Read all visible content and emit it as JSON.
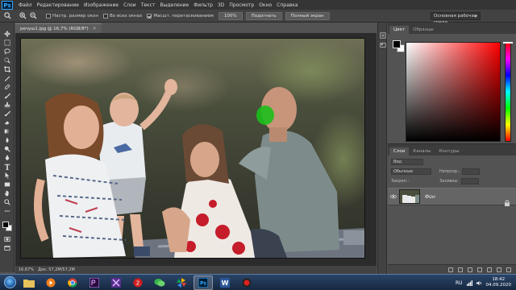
{
  "app": {
    "logo": "Ps"
  },
  "menu": [
    "Файл",
    "Редактирование",
    "Изображение",
    "Слои",
    "Текст",
    "Выделение",
    "Фильтр",
    "3D",
    "Просмотр",
    "Окно",
    "Справка"
  ],
  "options": {
    "resize_label": "Настр. размер окон",
    "all_windows_label": "Во всех окнах",
    "scrubby_label": "Масшт. перетаскиванием",
    "zoom100_label": "100%",
    "fit_label": "Подогнать",
    "fullscreen_label": "Полный экран",
    "workspace": "Основная рабочая среда"
  },
  "document": {
    "tab": "речуш1.jpg @ 16,7% (RGB/8*)",
    "close": "×"
  },
  "status": {
    "zoom": "16,67%",
    "doc": "Док: 57,2M/57,2M"
  },
  "color_panel": {
    "tabs": [
      "Цвет",
      "Образцы"
    ]
  },
  "layers_panel": {
    "tabs": [
      "Слои",
      "Каналы",
      "Контуры"
    ],
    "kind_label": "Вид",
    "mode": "Обычные",
    "opacity_label": "Непрозр.:",
    "lock_label": "Закреп.:",
    "fill_label": "Заливка:",
    "layer_name": "Фон"
  },
  "taskbar": {
    "lang": "RU",
    "time": "18:42",
    "date": "04.09.2020"
  },
  "colors": {
    "menubar": "#353535",
    "panel": "#535353",
    "accent": "#31a8ff",
    "mask_green": "#1bbf1b"
  },
  "icons": [
    "home-icon",
    "zoom-in-icon",
    "zoom-out-icon",
    "move-tool-icon",
    "marquee-tool-icon",
    "lasso-tool-icon",
    "crop-tool-icon",
    "eyedropper-tool-icon",
    "brush-tool-icon",
    "eraser-tool-icon",
    "type-tool-icon",
    "hand-tool-icon",
    "zoom-tool-icon",
    "eye-icon",
    "lock-icon"
  ]
}
